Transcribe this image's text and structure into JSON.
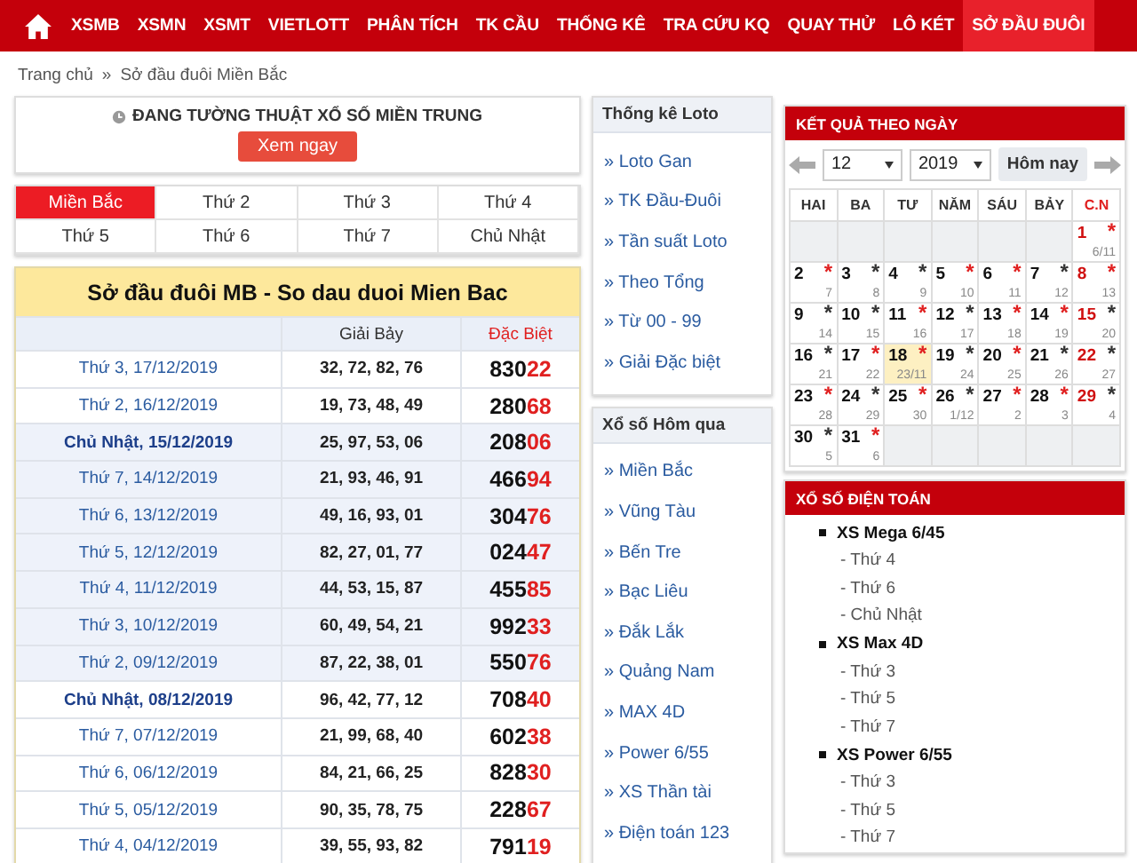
{
  "nav": {
    "items": [
      {
        "label": "XSMB",
        "selected": false
      },
      {
        "label": "XSMN",
        "selected": false
      },
      {
        "label": "XSMT",
        "selected": false
      },
      {
        "label": "VIETLOTT",
        "selected": false
      },
      {
        "label": "PHÂN TÍCH",
        "selected": false
      },
      {
        "label": "TK CẦU",
        "selected": false
      },
      {
        "label": "THỐNG KÊ",
        "selected": false
      },
      {
        "label": "TRA CỨU KQ",
        "selected": false
      },
      {
        "label": "QUAY THỬ",
        "selected": false
      },
      {
        "label": "LÔ KÉT",
        "selected": false
      },
      {
        "label": "SỞ ĐẦU ĐUÔI",
        "selected": true
      }
    ]
  },
  "breadcrumb": {
    "items": [
      "Trang chủ",
      "Sở đầu đuôi Miền Bắc"
    ],
    "separator": "»"
  },
  "live_banner": {
    "text": "ĐANG TƯỜNG THUẬT XỔ SỐ MIỀN TRUNG",
    "button": "Xem ngay"
  },
  "region_tabs": [
    {
      "label": "Miền Bắc",
      "selected": true
    },
    {
      "label": "Thứ 2",
      "selected": false
    },
    {
      "label": "Thứ 3",
      "selected": false
    },
    {
      "label": "Thứ 4",
      "selected": false
    },
    {
      "label": "Thứ 5",
      "selected": false
    },
    {
      "label": "Thứ 6",
      "selected": false
    },
    {
      "label": "Thứ 7",
      "selected": false
    },
    {
      "label": "Chủ Nhật",
      "selected": false
    }
  ],
  "table": {
    "title": "Sở đầu đuôi MB - So dau duoi Mien Bac",
    "columns": [
      "Giải Bảy",
      "Đặc Biệt"
    ],
    "rows": [
      {
        "date": "Thứ 3, 17/12/2019",
        "seventh": "32, 72, 82, 76",
        "special_head": "830",
        "special_tail": "22",
        "shaded": false,
        "sunday": false
      },
      {
        "date": "Thứ 2, 16/12/2019",
        "seventh": "19, 73, 48, 49",
        "special_head": "280",
        "special_tail": "68",
        "shaded": false,
        "sunday": false
      },
      {
        "date": "Chủ Nhật, 15/12/2019",
        "seventh": "25, 97, 53, 06",
        "special_head": "208",
        "special_tail": "06",
        "shaded": true,
        "sunday": true
      },
      {
        "date": "Thứ 7, 14/12/2019",
        "seventh": "21, 93, 46, 91",
        "special_head": "466",
        "special_tail": "94",
        "shaded": true,
        "sunday": false
      },
      {
        "date": "Thứ 6, 13/12/2019",
        "seventh": "49, 16, 93, 01",
        "special_head": "304",
        "special_tail": "76",
        "shaded": true,
        "sunday": false
      },
      {
        "date": "Thứ 5, 12/12/2019",
        "seventh": "82, 27, 01, 77",
        "special_head": "024",
        "special_tail": "47",
        "shaded": true,
        "sunday": false
      },
      {
        "date": "Thứ 4, 11/12/2019",
        "seventh": "44, 53, 15, 87",
        "special_head": "455",
        "special_tail": "85",
        "shaded": true,
        "sunday": false
      },
      {
        "date": "Thứ 3, 10/12/2019",
        "seventh": "60, 49, 54, 21",
        "special_head": "992",
        "special_tail": "33",
        "shaded": true,
        "sunday": false
      },
      {
        "date": "Thứ 2, 09/12/2019",
        "seventh": "87, 22, 38, 01",
        "special_head": "550",
        "special_tail": "76",
        "shaded": true,
        "sunday": false
      },
      {
        "date": "Chủ Nhật, 08/12/2019",
        "seventh": "96, 42, 77, 12",
        "special_head": "708",
        "special_tail": "40",
        "shaded": false,
        "sunday": true
      },
      {
        "date": "Thứ 7, 07/12/2019",
        "seventh": "21, 99, 68, 40",
        "special_head": "602",
        "special_tail": "38",
        "shaded": false,
        "sunday": false
      },
      {
        "date": "Thứ 6, 06/12/2019",
        "seventh": "84, 21, 66, 25",
        "special_head": "828",
        "special_tail": "30",
        "shaded": false,
        "sunday": false
      },
      {
        "date": "Thứ 5, 05/12/2019",
        "seventh": "90, 35, 78, 75",
        "special_head": "228",
        "special_tail": "67",
        "shaded": false,
        "sunday": false
      },
      {
        "date": "Thứ 4, 04/12/2019",
        "seventh": "39, 55, 93, 82",
        "special_head": "791",
        "special_tail": "19",
        "shaded": false,
        "sunday": false
      }
    ]
  },
  "side_panels": [
    {
      "title": "Thống kê Loto",
      "links": [
        "» Loto Gan",
        "» TK Đầu-Đuôi",
        "» Tần suất Loto",
        "» Theo Tổng",
        "» Từ 00 - 99",
        "» Giải Đặc biệt"
      ]
    },
    {
      "title": "Xổ số Hôm qua",
      "links": [
        "» Miền Bắc",
        "» Vũng Tàu",
        "» Bến Tre",
        "» Bạc Liêu",
        "» Đắk Lắk",
        "» Quảng Nam",
        "» MAX 4D",
        "» Power 6/55",
        "» XS Thần tài",
        "» Điện toán 123"
      ]
    }
  ],
  "calendar": {
    "title": "KẾT QUẢ THEO NGÀY",
    "month": "12",
    "year": "2019",
    "today_button": "Hôm nay",
    "star": "*",
    "weekdays": [
      "HAI",
      "BA",
      "TƯ",
      "NĂM",
      "SÁU",
      "BẢY",
      "C.N"
    ],
    "weeks": [
      [
        {
          "kind": "blank"
        },
        {
          "kind": "blank"
        },
        {
          "kind": "blank"
        },
        {
          "kind": "blank"
        },
        {
          "kind": "blank"
        },
        {
          "kind": "blank"
        },
        {
          "kind": "day",
          "day": "1",
          "lunar": "6/11",
          "color": "#e02020",
          "today": false
        }
      ],
      [
        {
          "kind": "day",
          "day": "2",
          "lunar": "7",
          "color": "#e02020",
          "today": false
        },
        {
          "kind": "day",
          "day": "3",
          "lunar": "8",
          "color": "#333333",
          "today": false
        },
        {
          "kind": "day",
          "day": "4",
          "lunar": "9",
          "color": "#333333",
          "today": false
        },
        {
          "kind": "day",
          "day": "5",
          "lunar": "10",
          "color": "#e02020",
          "today": false
        },
        {
          "kind": "day",
          "day": "6",
          "lunar": "11",
          "color": "#e02020",
          "today": false
        },
        {
          "kind": "day",
          "day": "7",
          "lunar": "12",
          "color": "#333333",
          "today": false
        },
        {
          "kind": "day",
          "day": "8",
          "lunar": "13",
          "color": "#e02020",
          "today": false
        }
      ],
      [
        {
          "kind": "day",
          "day": "9",
          "lunar": "14",
          "color": "#333333",
          "today": false
        },
        {
          "kind": "day",
          "day": "10",
          "lunar": "15",
          "color": "#333333",
          "today": false
        },
        {
          "kind": "day",
          "day": "11",
          "lunar": "16",
          "color": "#e02020",
          "today": false
        },
        {
          "kind": "day",
          "day": "12",
          "lunar": "17",
          "color": "#333333",
          "today": false
        },
        {
          "kind": "day",
          "day": "13",
          "lunar": "18",
          "color": "#e02020",
          "today": false
        },
        {
          "kind": "day",
          "day": "14",
          "lunar": "19",
          "color": "#e02020",
          "today": false
        },
        {
          "kind": "day",
          "day": "15",
          "lunar": "20",
          "color": "#333333",
          "today": false
        }
      ],
      [
        {
          "kind": "day",
          "day": "16",
          "lunar": "21",
          "color": "#333333",
          "today": false
        },
        {
          "kind": "day",
          "day": "17",
          "lunar": "22",
          "color": "#e02020",
          "today": false
        },
        {
          "kind": "day",
          "day": "18",
          "lunar": "23/11",
          "color": "#e02020",
          "today": true
        },
        {
          "kind": "day",
          "day": "19",
          "lunar": "24",
          "color": "#333333",
          "today": false
        },
        {
          "kind": "day",
          "day": "20",
          "lunar": "25",
          "color": "#e02020",
          "today": false
        },
        {
          "kind": "day",
          "day": "21",
          "lunar": "26",
          "color": "#333333",
          "today": false
        },
        {
          "kind": "day",
          "day": "22",
          "lunar": "27",
          "color": "#333333",
          "today": false
        }
      ],
      [
        {
          "kind": "day",
          "day": "23",
          "lunar": "28",
          "color": "#e02020",
          "today": false
        },
        {
          "kind": "day",
          "day": "24",
          "lunar": "29",
          "color": "#333333",
          "today": false
        },
        {
          "kind": "day",
          "day": "25",
          "lunar": "30",
          "color": "#e02020",
          "today": false
        },
        {
          "kind": "day",
          "day": "26",
          "lunar": "1/12",
          "color": "#333333",
          "today": false
        },
        {
          "kind": "day",
          "day": "27",
          "lunar": "2",
          "color": "#e02020",
          "today": false
        },
        {
          "kind": "day",
          "day": "28",
          "lunar": "3",
          "color": "#e02020",
          "today": false
        },
        {
          "kind": "day",
          "day": "29",
          "lunar": "4",
          "color": "#333333",
          "today": false
        }
      ],
      [
        {
          "kind": "day",
          "day": "30",
          "lunar": "5",
          "color": "#333333",
          "today": false
        },
        {
          "kind": "day",
          "day": "31",
          "lunar": "6",
          "color": "#e02020",
          "today": false
        },
        {
          "kind": "blank"
        },
        {
          "kind": "blank"
        },
        {
          "kind": "blank"
        },
        {
          "kind": "blank"
        },
        {
          "kind": "blank"
        }
      ]
    ]
  },
  "computer_lottery": {
    "title": "XỔ SỐ ĐIỆN TOÁN",
    "groups": [
      {
        "label": "XS Mega 6/45",
        "children": [
          "- Thứ 4",
          "- Thứ 6",
          "- Chủ Nhật"
        ]
      },
      {
        "label": "XS Max 4D",
        "children": [
          "- Thứ 3",
          "- Thứ 5",
          "- Thứ 7"
        ]
      },
      {
        "label": "XS Power 6/55",
        "children": [
          "- Thứ 3",
          "- Thứ 5",
          "- Thứ 7"
        ]
      }
    ]
  }
}
